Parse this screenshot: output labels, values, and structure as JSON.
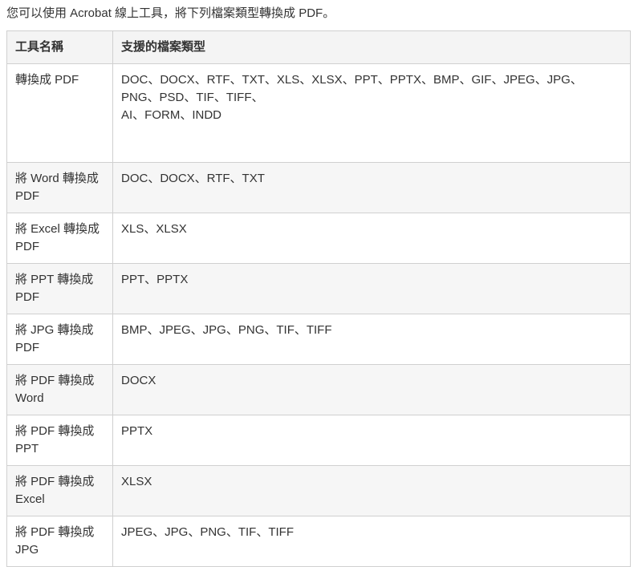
{
  "intro": "您可以使用 Acrobat 線上工具，將下列檔案類型轉換成 PDF。",
  "table": {
    "headers": [
      "工具名稱",
      "支援的檔案類型"
    ],
    "rows": [
      {
        "tool": "轉換成 PDF",
        "formats": [
          "DOC、DOCX、RTF、TXT、XLS、XLSX、PPT、PPTX、BMP、GIF、JPEG、JPG、",
          "PNG、PSD、TIF、TIFF、",
          "AI、FORM、INDD"
        ]
      },
      {
        "tool": "將 Word 轉換成 PDF",
        "formats": [
          "DOC、DOCX、RTF、TXT"
        ]
      },
      {
        "tool": "將 Excel 轉換成 PDF",
        "formats": [
          "XLS、XLSX"
        ]
      },
      {
        "tool": "將 PPT 轉換成 PDF",
        "formats": [
          "PPT、PPTX"
        ]
      },
      {
        "tool": "將 JPG 轉換成 PDF",
        "formats": [
          "BMP、JPEG、JPG、PNG、TIF、TIFF"
        ]
      },
      {
        "tool": "將 PDF 轉換成 Word",
        "formats": [
          "DOCX"
        ]
      },
      {
        "tool": "將 PDF 轉換成 PPT",
        "formats": [
          "PPTX"
        ]
      },
      {
        "tool": "將 PDF 轉換成 Excel",
        "formats": [
          "XLSX"
        ]
      },
      {
        "tool": "將 PDF 轉換成 JPG",
        "formats": [
          "JPEG、JPG、PNG、TIF、TIFF"
        ]
      }
    ]
  }
}
